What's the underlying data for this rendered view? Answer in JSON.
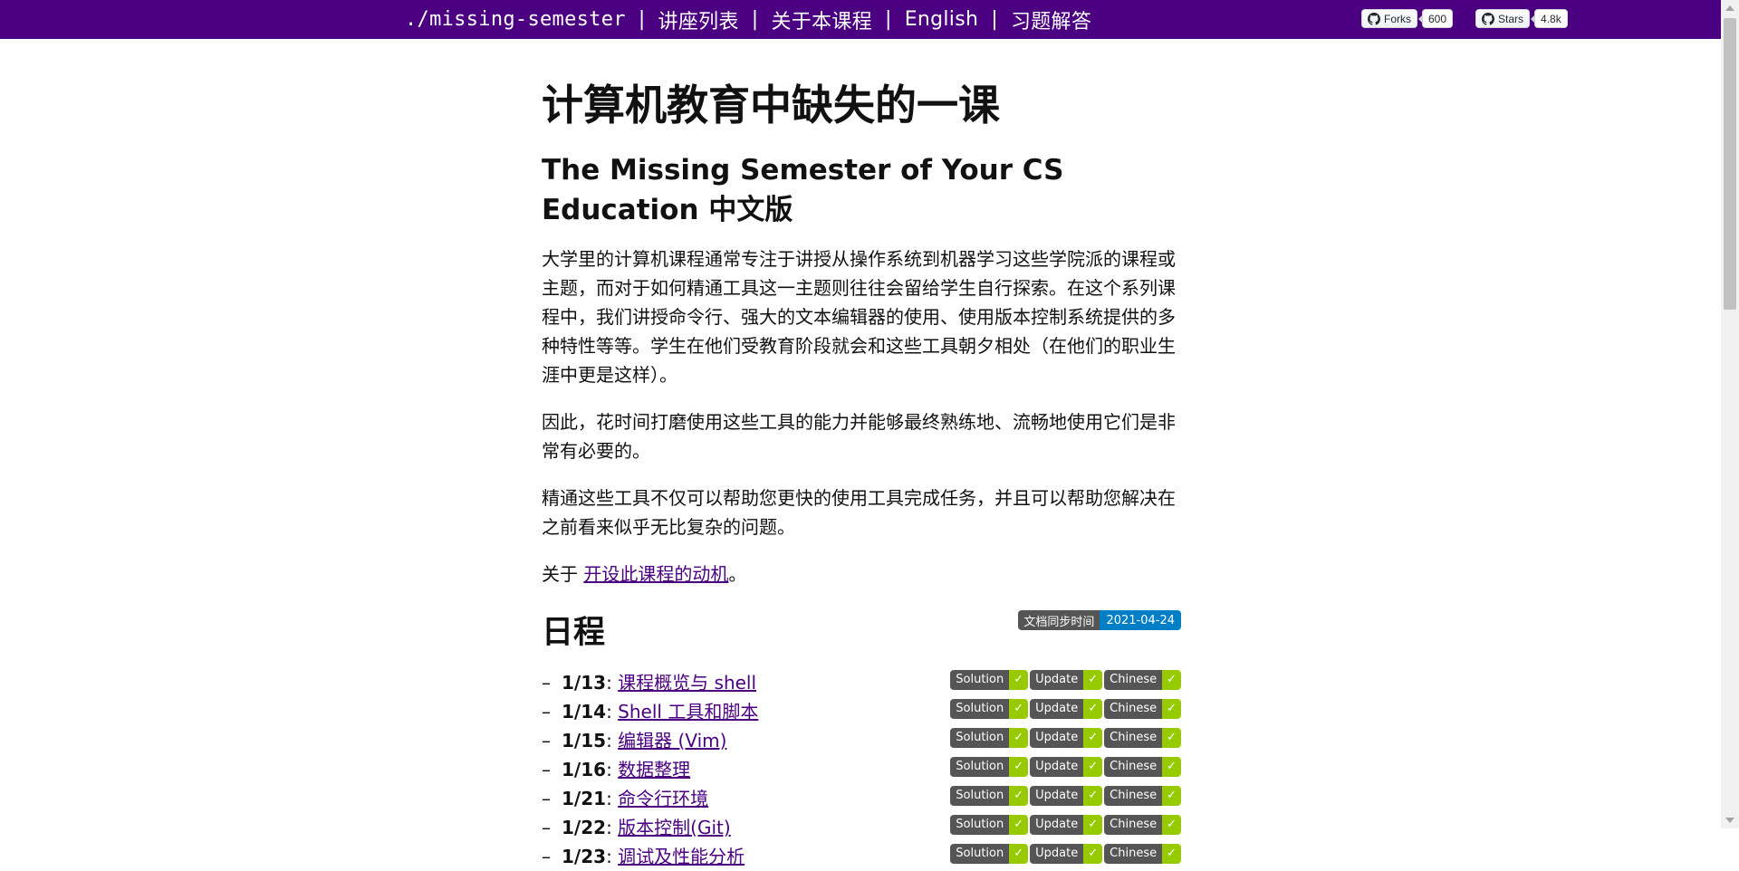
{
  "nav": {
    "brand": "./missing-semester",
    "sep": "|",
    "items": [
      "讲座列表",
      "关于本课程",
      "English",
      "习题解答"
    ]
  },
  "github": {
    "forks_label": "Forks",
    "forks_count": "600",
    "stars_label": "Stars",
    "stars_count": "4.8k"
  },
  "page": {
    "title": "计算机教育中缺失的一课",
    "subtitle": "The Missing Semester of Your CS Education 中文版",
    "para1": "大学里的计算机课程通常专注于讲授从操作系统到机器学习这些学院派的课程或主题，而对于如何精通工具这一主题则往往会留给学生自行探索。在这个系列课程中，我们讲授命令行、强大的文本编辑器的使用、使用版本控制系统提供的多种特性等等。学生在他们受教育阶段就会和这些工具朝夕相处（在他们的职业生涯中更是这样）。",
    "para2": "因此，花时间打磨使用这些工具的能力并能够最终熟练地、流畅地使用它们是非常有必要的。",
    "para3": "精通这些工具不仅可以帮助您更快的使用工具完成任务，并且可以帮助您解决在之前看来似乎无比复杂的问题。",
    "about_prefix": "关于 ",
    "about_link": "开设此课程的动机",
    "about_suffix": "。"
  },
  "schedule": {
    "heading": "日程",
    "sync_label": "文档同步时间",
    "sync_date": "2021-04-24",
    "dash": "–",
    "badge_labels": [
      "Solution",
      "Update",
      "Chinese"
    ],
    "check": "✓",
    "lectures": [
      {
        "date": "1/13",
        "sep": ": ",
        "title": "课程概览与 shell"
      },
      {
        "date": "1/14",
        "sep": ": ",
        "title": "Shell 工具和脚本"
      },
      {
        "date": "1/15",
        "sep": ": ",
        "title": "编辑器 (Vim)"
      },
      {
        "date": "1/16",
        "sep": ": ",
        "title": "数据整理"
      },
      {
        "date": "1/21",
        "sep": ": ",
        "title": "命令行环境"
      },
      {
        "date": "1/22",
        "sep": ": ",
        "title": "版本控制(Git)"
      },
      {
        "date": "1/23",
        "sep": ": ",
        "title": "调试及性能分析"
      }
    ]
  },
  "colors": {
    "navbar": "#4b0082",
    "link": "#4b0082",
    "badge_dark": "#555555",
    "badge_green": "#97ca00",
    "badge_blue": "#007ec6"
  }
}
